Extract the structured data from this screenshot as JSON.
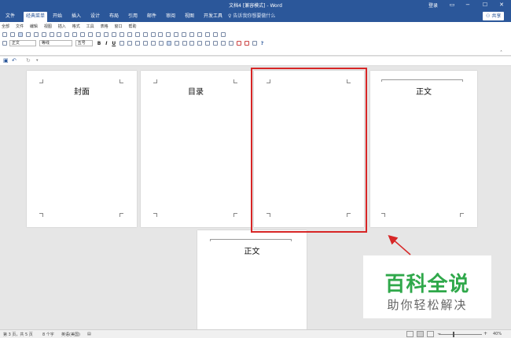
{
  "window": {
    "title": "文档4 [兼容模式] - Word",
    "login": "登录",
    "min": "−",
    "restore": "☐",
    "close": "✕"
  },
  "tabs": [
    "文件",
    "经典菜单",
    "开始",
    "插入",
    "设计",
    "布局",
    "引用",
    "邮件",
    "审阅",
    "视图",
    "开发工具"
  ],
  "active_tab": "经典菜单",
  "tell_me": "告诉我你想要做什么",
  "share": "共享",
  "classic_menu": [
    "全部",
    "文件",
    "编辑",
    "视图",
    "插入",
    "格式",
    "工具",
    "表格",
    "窗口",
    "帮助"
  ],
  "ribbon": {
    "style_value": "正文",
    "font_value": "等线",
    "size_value": "五号",
    "bold": "B",
    "italic": "I",
    "underline": "U",
    "help": "?"
  },
  "quick_access": {
    "save_icon": "save-icon",
    "undo_icon": "undo-icon",
    "redo_icon": "redo-icon"
  },
  "pages": [
    {
      "title": "封面"
    },
    {
      "title": "目录"
    },
    {
      "title": ""
    },
    {
      "title": "正文"
    },
    {
      "title": "正文"
    }
  ],
  "watermark": {
    "main": "百科全说",
    "sub": "助你轻松解决"
  },
  "status": {
    "page": "第 3 页，共 5 页",
    "words": "8 个字",
    "language": "英语(美国)",
    "zoom": "40%",
    "zoom_fraction": 0.4
  },
  "colors": {
    "title_bar": "#2b579a",
    "highlight": "#d72626",
    "watermark_green": "#2fa84a"
  }
}
